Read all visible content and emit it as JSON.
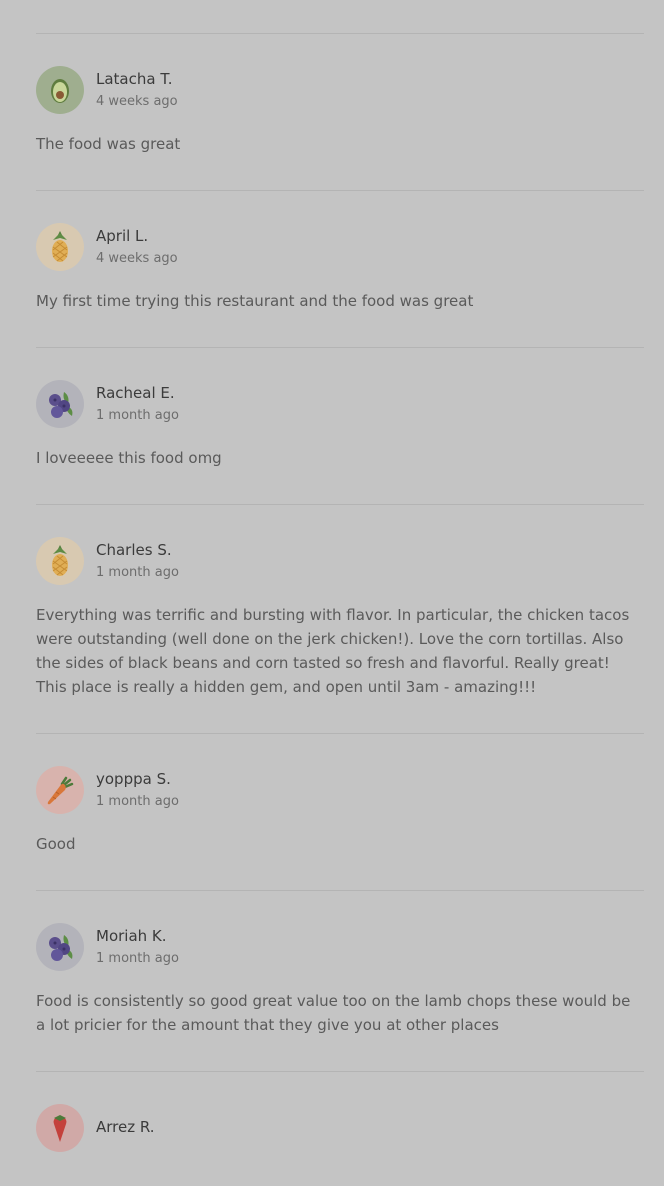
{
  "reviews": [
    {
      "name": "Latacha T.",
      "time": "4 weeks ago",
      "text": "The food was great",
      "avatar": "avocado-icon",
      "avatar_bg": "#9fae8f"
    },
    {
      "name": "April L.",
      "time": "4 weeks ago",
      "text": "My first time trying this restaurant and the food was great",
      "avatar": "pineapple-icon",
      "avatar_bg": "#d8c9b1"
    },
    {
      "name": "Racheal E.",
      "time": "1 month ago",
      "text": "I loveeeee this food omg",
      "avatar": "blueberry-icon",
      "avatar_bg": "#b3b3ba"
    },
    {
      "name": "Charles S.",
      "time": "1 month ago",
      "text": "Everything was terrific and bursting with flavor. In particular, the chicken tacos were outstanding (well done on the jerk chicken!). Love the corn tortillas. Also the sides of black beans and corn tasted so fresh and flavorful. Really great! This place is really a hidden gem, and open until 3am - amazing!!!",
      "avatar": "pineapple-icon",
      "avatar_bg": "#d8c9b1"
    },
    {
      "name": "yopppa S.",
      "time": "1 month ago",
      "text": "Good",
      "avatar": "carrot-icon",
      "avatar_bg": "#d8b3ad"
    },
    {
      "name": "Moriah K.",
      "time": "1 month ago",
      "text": "Food is consistently so good great value too on the lamb chops these would be a lot pricier for the amount that they give you at other places",
      "avatar": "blueberry-icon",
      "avatar_bg": "#b3b3ba"
    },
    {
      "name": "Arrez R.",
      "time": "",
      "text": "",
      "avatar": "strawberry-icon",
      "avatar_bg": "#d0a9a7"
    }
  ]
}
